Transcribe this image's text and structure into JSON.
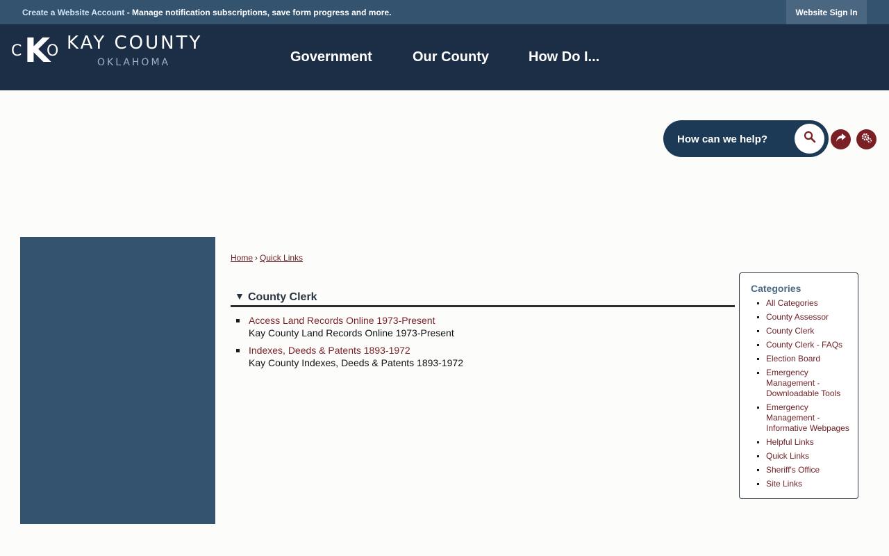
{
  "topbar": {
    "account_link": "Create a Website Account",
    "account_rest": " - Manage notification subscriptions, save form progress and more.",
    "signin_label": "Website Sign In"
  },
  "logo": {
    "c": "C",
    "k": "K",
    "o": "O",
    "name": "KAY COUNTY",
    "state": "OKLAHOMA"
  },
  "nav": [
    {
      "label": "Government"
    },
    {
      "label": "Our County"
    },
    {
      "label": "How Do I..."
    }
  ],
  "search": {
    "placeholder": "How can we help?"
  },
  "breadcrumb": {
    "home": "Home",
    "sep": "›",
    "current": "Quick Links"
  },
  "section": {
    "toggle": "▼",
    "title": "County Clerk",
    "links": [
      {
        "title": "Access Land Records Online 1973-Present",
        "desc": "Kay County Land Records Online 1973-Present"
      },
      {
        "title": "Indexes, Deeds & Patents 1893-1972",
        "desc": "Kay County Indexes, Deeds & Patents 1893-1972"
      }
    ]
  },
  "categories": {
    "title": "Categories",
    "items": [
      "All Categories",
      "County Assessor",
      "County Clerk",
      "County Clerk - FAQs",
      "Election Board",
      "Emergency Management - Downloadable Tools",
      "Emergency Management - Informative Webpages",
      "Helpful Links",
      "Quick Links",
      "Sheriff's Office",
      "Site Links"
    ]
  },
  "colors": {
    "topbar": "#34536e",
    "header": "#1c2e45",
    "accent": "#7a1f24",
    "sidepanel": "#34536e"
  },
  "icons": {
    "search": "search-icon",
    "share": "share-icon",
    "settings": "settings-icon"
  }
}
